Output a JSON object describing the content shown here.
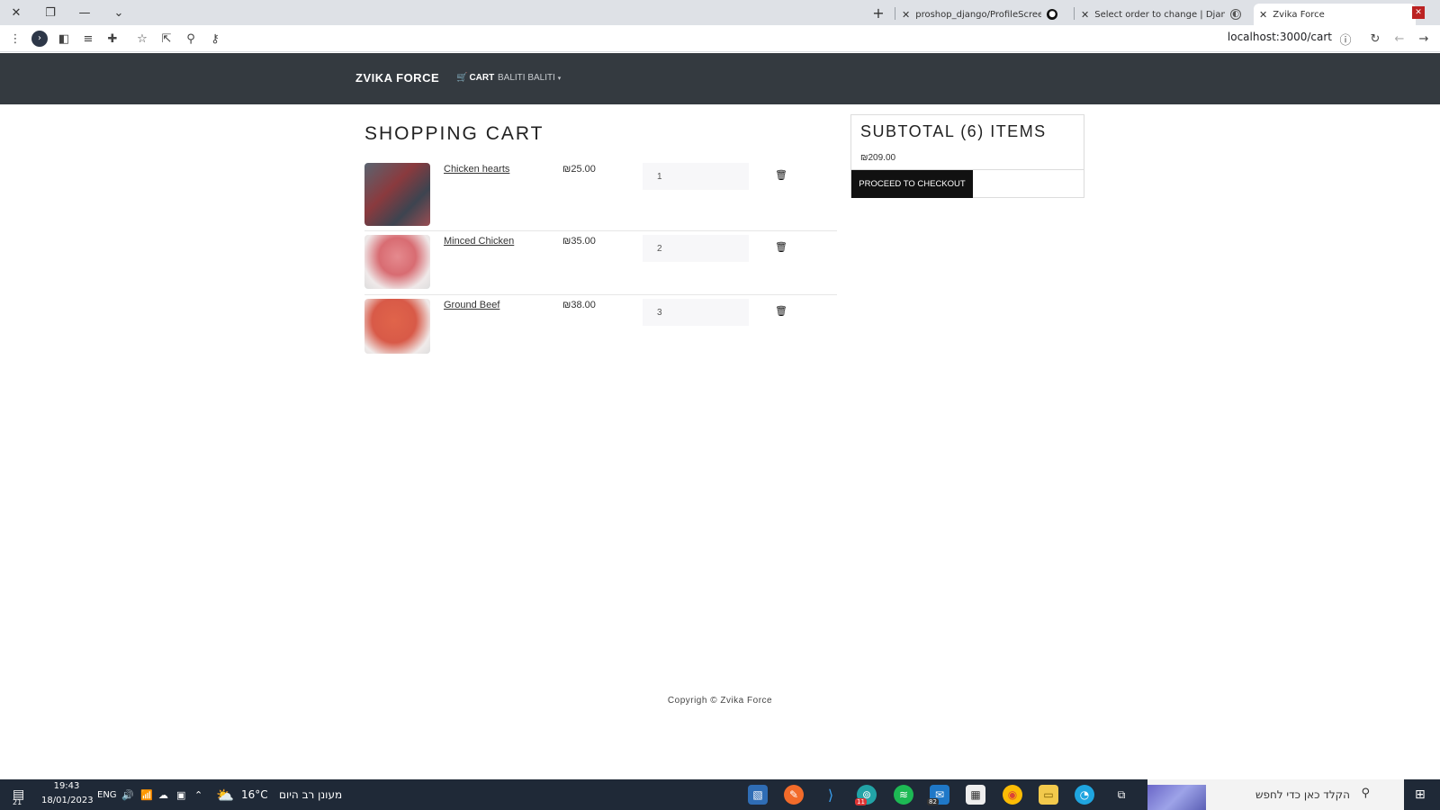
{
  "browser": {
    "tabs": [
      {
        "title": "proshop_django/ProfileScreen.js"
      },
      {
        "title": "Select order to change | Django"
      },
      {
        "title": "Zvika Force"
      }
    ],
    "new_tab": "+",
    "url": "localhost:3000/cart"
  },
  "navbar": {
    "brand": "ZVIKA FORCE",
    "cart_label": "CART",
    "user_label": "BALITI BALITI"
  },
  "cart": {
    "title": "SHOPPING CART",
    "items": [
      {
        "name": "Chicken hearts",
        "price": "₪25.00",
        "qty": "1"
      },
      {
        "name": "Minced Chicken",
        "price": "₪35.00",
        "qty": "2"
      },
      {
        "name": "Ground Beef",
        "price": "₪38.00",
        "qty": "3"
      }
    ]
  },
  "summary": {
    "title": "SUBTOTAL (6) ITEMS",
    "amount": "₪209.00",
    "button": "PROCEED TO CHECKOUT"
  },
  "footer": {
    "text": "Copyrigh © Zvika Force"
  },
  "taskbar": {
    "notif_count": "21",
    "time": "19:43",
    "date": "18/01/2023",
    "lang": "ENG",
    "weather_temp": "16°C",
    "weather_text": "מעונן רב היום",
    "search_placeholder": "הקלד כאן כדי לחפש",
    "badge_a": "11",
    "badge_b": "82"
  }
}
